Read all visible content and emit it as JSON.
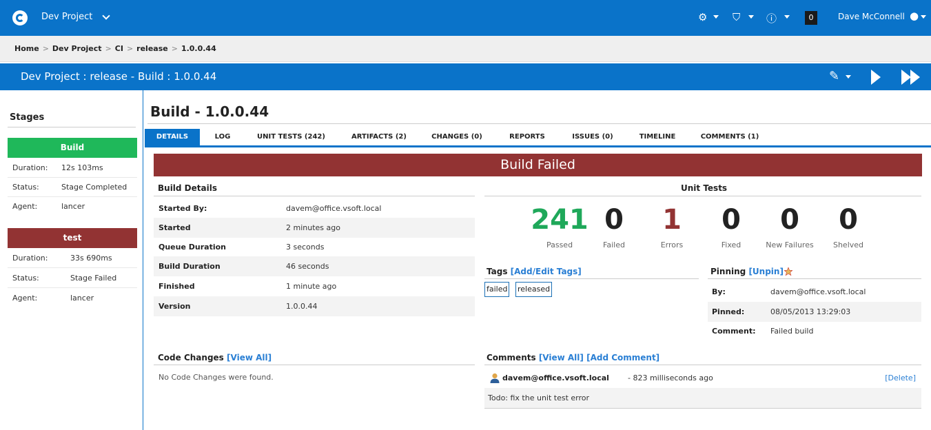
{
  "topbar": {
    "project_name": "Dev Project",
    "count_badge": "0",
    "user_name": "Dave McConnell"
  },
  "breadcrumb": {
    "items": [
      "Home",
      "Dev Project",
      "CI",
      "release",
      "1.0.0.44"
    ],
    "separator": ">"
  },
  "titlebar": {
    "title": "Dev Project : release - Build : 1.0.0.44"
  },
  "sidebar": {
    "heading": "Stages",
    "stages": [
      {
        "name": "Build",
        "color": "#1fb85a",
        "duration_label": "Duration:",
        "duration": "12s 103ms",
        "status_label": "Status:",
        "status": "Stage Completed",
        "agent_label": "Agent:",
        "agent": "lancer"
      },
      {
        "name": "test",
        "color": "#923333",
        "duration_label": "Duration:",
        "duration": "33s 690ms",
        "status_label": "Status:",
        "status": "Stage Failed",
        "agent_label": "Agent:",
        "agent": "lancer"
      }
    ]
  },
  "main": {
    "title": "Build - 1.0.0.44",
    "tabs": [
      {
        "label": "DETAILS",
        "active": true
      },
      {
        "label": "LOG"
      },
      {
        "label": "UNIT TESTS (242)"
      },
      {
        "label": "ARTIFACTS (2)"
      },
      {
        "label": "CHANGES (0)"
      },
      {
        "label": "REPORTS"
      },
      {
        "label": "ISSUES (0)"
      },
      {
        "label": "TIMELINE"
      },
      {
        "label": "COMMENTS (1)"
      }
    ],
    "banner": "Build Failed",
    "banner_color": "#923333"
  },
  "build_details": {
    "heading": "Build Details",
    "rows": [
      {
        "key": "Started By:",
        "value": "davem@office.vsoft.local"
      },
      {
        "key": "Started",
        "value": "2 minutes ago"
      },
      {
        "key": "Queue Duration",
        "value": "3 seconds"
      },
      {
        "key": "Build Duration",
        "value": "46 seconds"
      },
      {
        "key": "Finished",
        "value": "1 minute ago"
      },
      {
        "key": "Version",
        "value": "1.0.0.44"
      }
    ]
  },
  "unit_tests": {
    "heading": "Unit Tests",
    "stats": [
      {
        "value": "241",
        "label": "Passed",
        "color": "#1fa85a"
      },
      {
        "value": "0",
        "label": "Failed",
        "color": "#222222"
      },
      {
        "value": "1",
        "label": "Errors",
        "color": "#923333"
      },
      {
        "value": "0",
        "label": "Fixed",
        "color": "#222222"
      },
      {
        "value": "0",
        "label": "New Failures",
        "color": "#222222"
      },
      {
        "value": "0",
        "label": "Shelved",
        "color": "#222222"
      }
    ]
  },
  "tags": {
    "heading": "Tags",
    "edit_link": "[Add/Edit Tags]",
    "items": [
      "failed",
      "released"
    ]
  },
  "pinning": {
    "heading": "Pinning",
    "unpin_link": "[Unpin]",
    "rows": [
      {
        "key": "By:",
        "value": "davem@office.vsoft.local"
      },
      {
        "key": "Pinned:",
        "value": "08/05/2013 13:29:03"
      },
      {
        "key": "Comment:",
        "value": "Failed build"
      }
    ]
  },
  "code_changes": {
    "heading": "Code Changes",
    "view_all_link": "[View All]",
    "empty_text": "No Code Changes were found."
  },
  "comments": {
    "heading": "Comments",
    "view_all_link": "[View All]",
    "add_link": "[Add Comment]",
    "items": [
      {
        "author": "davem@office.vsoft.local",
        "time": "- 823 milliseconds ago",
        "delete_label": "[Delete]",
        "text": "Todo: fix the unit test error"
      }
    ]
  }
}
